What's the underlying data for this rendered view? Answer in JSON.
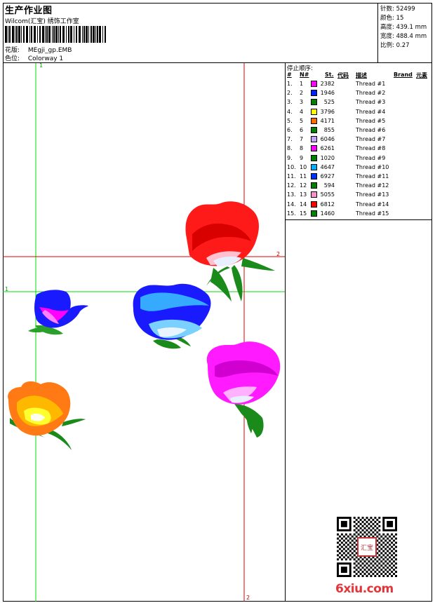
{
  "header": {
    "title": "生产作业图",
    "company": "Wilcom(汇宝) 绣饰工作室",
    "pattern_label": "花版:",
    "pattern_value": "MEgji_gp.EMB",
    "colorway_label": "色位:",
    "colorway_value": "Colorway 1"
  },
  "stats": {
    "stitches_label": "针数:",
    "stitches_value": "52499",
    "colors_label": "颜色:",
    "colors_value": "15",
    "height_label": "高度:",
    "height_value": "439.1 mm",
    "width_label": "宽度:",
    "width_value": "488.4 mm",
    "scale_label": "比例:",
    "scale_value": "0.27"
  },
  "canvas": {
    "marker_green_top": "1",
    "marker_green_left": "1",
    "marker_red_right": "2",
    "marker_red_bottom": "2"
  },
  "legend": {
    "stop_title": "停止顺序:",
    "headers": {
      "num": "#",
      "no": "N#",
      "st": "St.",
      "code": "代码",
      "desc": "描述",
      "brand": "Brand",
      "element": "元素"
    },
    "rows": [
      {
        "num": "1.",
        "no": "1",
        "st": "2382",
        "desc": "Thread #1",
        "color": "#ff00ff"
      },
      {
        "num": "2.",
        "no": "2",
        "st": "1946",
        "desc": "Thread #2",
        "color": "#0020ff"
      },
      {
        "num": "3.",
        "no": "3",
        "st": "525",
        "desc": "Thread #3",
        "color": "#008000"
      },
      {
        "num": "4.",
        "no": "4",
        "st": "3796",
        "desc": "Thread #4",
        "color": "#ffff00"
      },
      {
        "num": "5.",
        "no": "5",
        "st": "4171",
        "desc": "Thread #5",
        "color": "#ff6a00"
      },
      {
        "num": "6.",
        "no": "6",
        "st": "855",
        "desc": "Thread #6",
        "color": "#008000"
      },
      {
        "num": "7.",
        "no": "7",
        "st": "6046",
        "desc": "Thread #7",
        "color": "#c8a0ff"
      },
      {
        "num": "8.",
        "no": "8",
        "st": "6261",
        "desc": "Thread #8",
        "color": "#ff00ff"
      },
      {
        "num": "9.",
        "no": "9",
        "st": "1020",
        "desc": "Thread #9",
        "color": "#008000"
      },
      {
        "num": "10.",
        "no": "10",
        "st": "4647",
        "desc": "Thread #10",
        "color": "#00b0ff"
      },
      {
        "num": "11.",
        "no": "11",
        "st": "6927",
        "desc": "Thread #11",
        "color": "#0030ff"
      },
      {
        "num": "12.",
        "no": "12",
        "st": "594",
        "desc": "Thread #12",
        "color": "#008000"
      },
      {
        "num": "13.",
        "no": "13",
        "st": "5055",
        "desc": "Thread #13",
        "color": "#ff90d0"
      },
      {
        "num": "14.",
        "no": "14",
        "st": "6812",
        "desc": "Thread #14",
        "color": "#ff0000"
      },
      {
        "num": "15.",
        "no": "15",
        "st": "1460",
        "desc": "Thread #15",
        "color": "#008000"
      }
    ]
  },
  "watermark": {
    "site": "6xiu.com",
    "seal_text": "汇宝"
  }
}
